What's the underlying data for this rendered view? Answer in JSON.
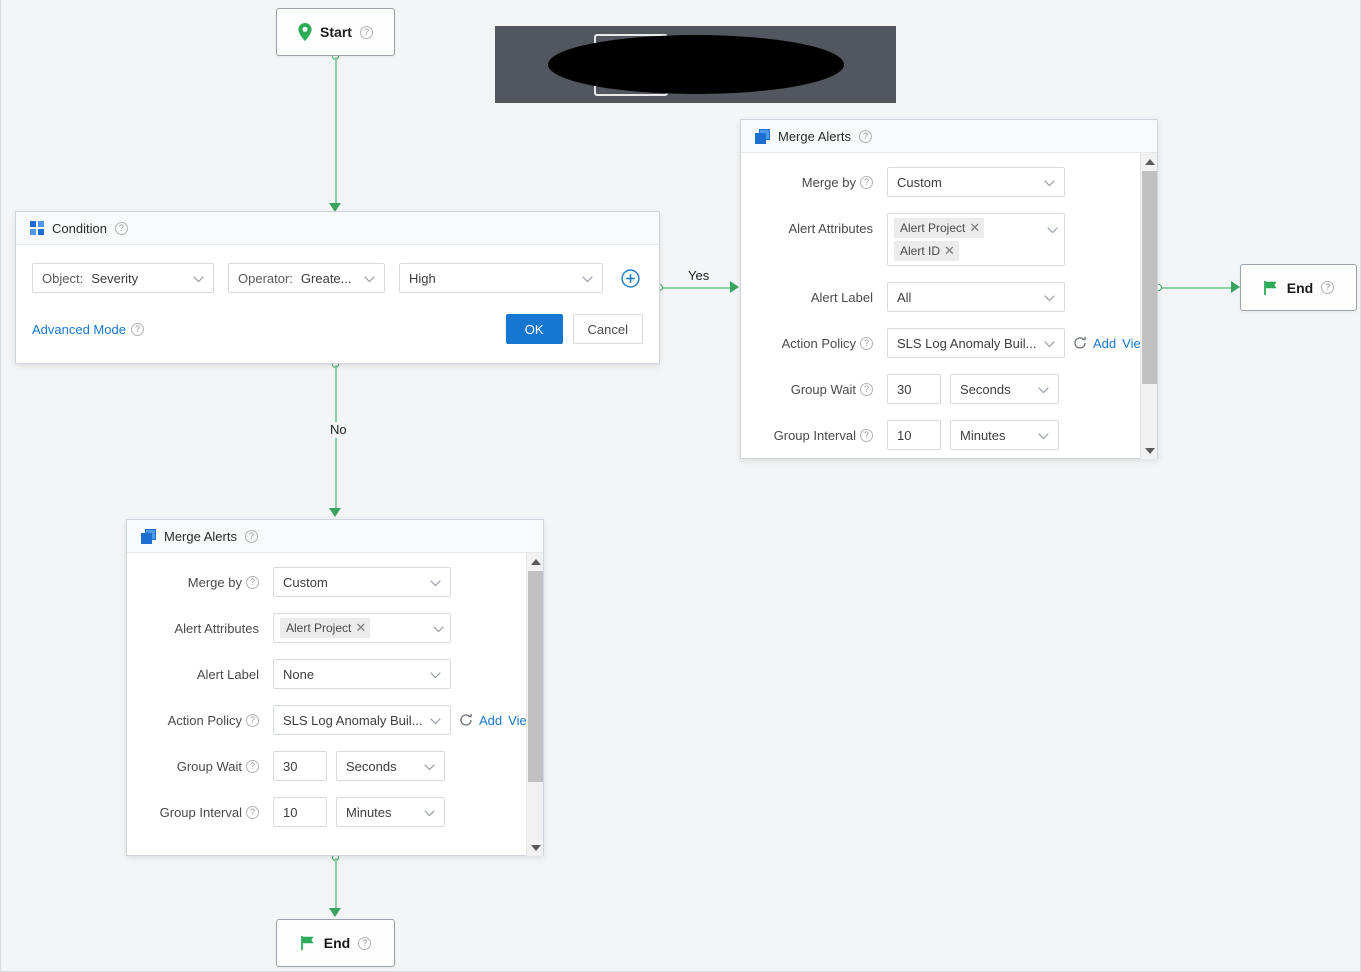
{
  "canvas": {
    "background": "#f4f5f7",
    "edge_color": "#8dcfa4",
    "arrow_color": "#3aa35f"
  },
  "nodes": {
    "start": {
      "label": "Start",
      "icon": "location-pin-icon",
      "help": "?",
      "icon_color": "#2cab58"
    },
    "end_right": {
      "label": "End",
      "icon": "flag-icon",
      "help": "?",
      "icon_color": "#2cab58"
    },
    "end_bottom": {
      "label": "End",
      "icon": "flag-icon",
      "help": "?",
      "icon_color": "#2cab58"
    }
  },
  "edges": {
    "yes_label": "Yes",
    "no_label": "No"
  },
  "condition_panel": {
    "title": "Condition",
    "icon": "grid-squares-icon",
    "help": "?",
    "object_label": "Object:",
    "object_value": "Severity",
    "operator_label": "Operator:",
    "operator_value": "Greate...",
    "value_value": "High",
    "add_icon": "plus-circle-icon",
    "advanced_mode": "Advanced Mode",
    "advanced_help": "?",
    "ok_label": "OK",
    "cancel_label": "Cancel",
    "primary_color": "#1677d2"
  },
  "merge_panel_top": {
    "title": "Merge Alerts",
    "icon": "merge-squares-icon",
    "help": "?",
    "rows": {
      "merge_by_label": "Merge by",
      "merge_by_value": "Custom",
      "alert_attributes_label": "Alert Attributes",
      "alert_attributes_tags": [
        "Alert Project",
        "Alert ID"
      ],
      "alert_label_label": "Alert Label",
      "alert_label_value": "All",
      "action_policy_label": "Action Policy",
      "action_policy_value": "SLS Log Anomaly Buil...",
      "action_policy_refresh_icon": "refresh-icon",
      "action_policy_add": "Add",
      "action_policy_view": "View",
      "group_wait_label": "Group Wait",
      "group_wait_value": "30",
      "group_wait_unit": "Seconds",
      "group_interval_label": "Group Interval",
      "group_interval_value": "10",
      "group_interval_unit": "Minutes"
    },
    "scrollbar": {
      "up_icon": "scroll-up-arrow-icon",
      "down_icon": "scroll-down-arrow-icon"
    }
  },
  "merge_panel_bottom": {
    "title": "Merge Alerts",
    "icon": "merge-squares-icon",
    "help": "?",
    "rows": {
      "merge_by_label": "Merge by",
      "merge_by_value": "Custom",
      "alert_attributes_label": "Alert Attributes",
      "alert_attributes_tags": [
        "Alert Project"
      ],
      "alert_label_label": "Alert Label",
      "alert_label_value": "None",
      "action_policy_label": "Action Policy",
      "action_policy_value": "SLS Log Anomaly Buil...",
      "action_policy_refresh_icon": "refresh-icon",
      "action_policy_add": "Add",
      "action_policy_view": "View",
      "group_wait_label": "Group Wait",
      "group_wait_value": "30",
      "group_wait_unit": "Seconds",
      "group_interval_label": "Group Interval",
      "group_interval_value": "10",
      "group_interval_unit": "Minutes"
    },
    "scrollbar": {
      "up_icon": "scroll-up-arrow-icon",
      "down_icon": "scroll-down-arrow-icon"
    }
  },
  "redacted_overlay": {
    "background": "#52565e",
    "mask_color": "#000000"
  }
}
